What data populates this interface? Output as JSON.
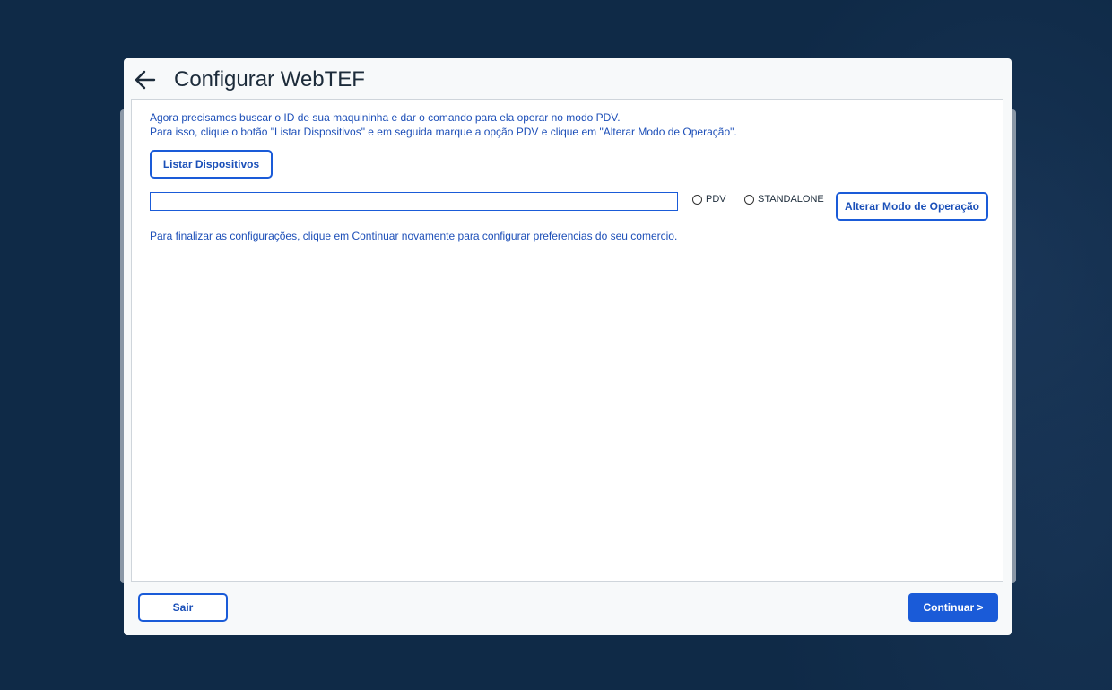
{
  "dialog": {
    "title": "Configurar WebTEF",
    "back_icon": "arrow-left-icon"
  },
  "content": {
    "instruction_line1": "Agora precisamos buscar o ID de sua maquininha e dar o comando para ela operar no modo PDV.",
    "instruction_line2": "Para isso, clique o botão \"Listar Dispositivos\"  e em seguida marque a opção PDV e clique em \"Alterar Modo de Operação\".",
    "list_devices_label": "Listar Dispositivos",
    "device_input_value": "",
    "mode_options": [
      {
        "label": "PDV",
        "selected": false
      },
      {
        "label": "STANDALONE",
        "selected": false
      }
    ],
    "change_mode_label": "Alterar Modo de Operação",
    "final_text": "Para finalizar as configurações, clique em Continuar novamente para configurar preferencias do seu comercio."
  },
  "footer": {
    "exit_label": "Sair",
    "continue_label": "Continuar >"
  },
  "colors": {
    "background": "#0f2a47",
    "accent": "#1a5bd8",
    "text_blue": "#1d4fb8"
  }
}
